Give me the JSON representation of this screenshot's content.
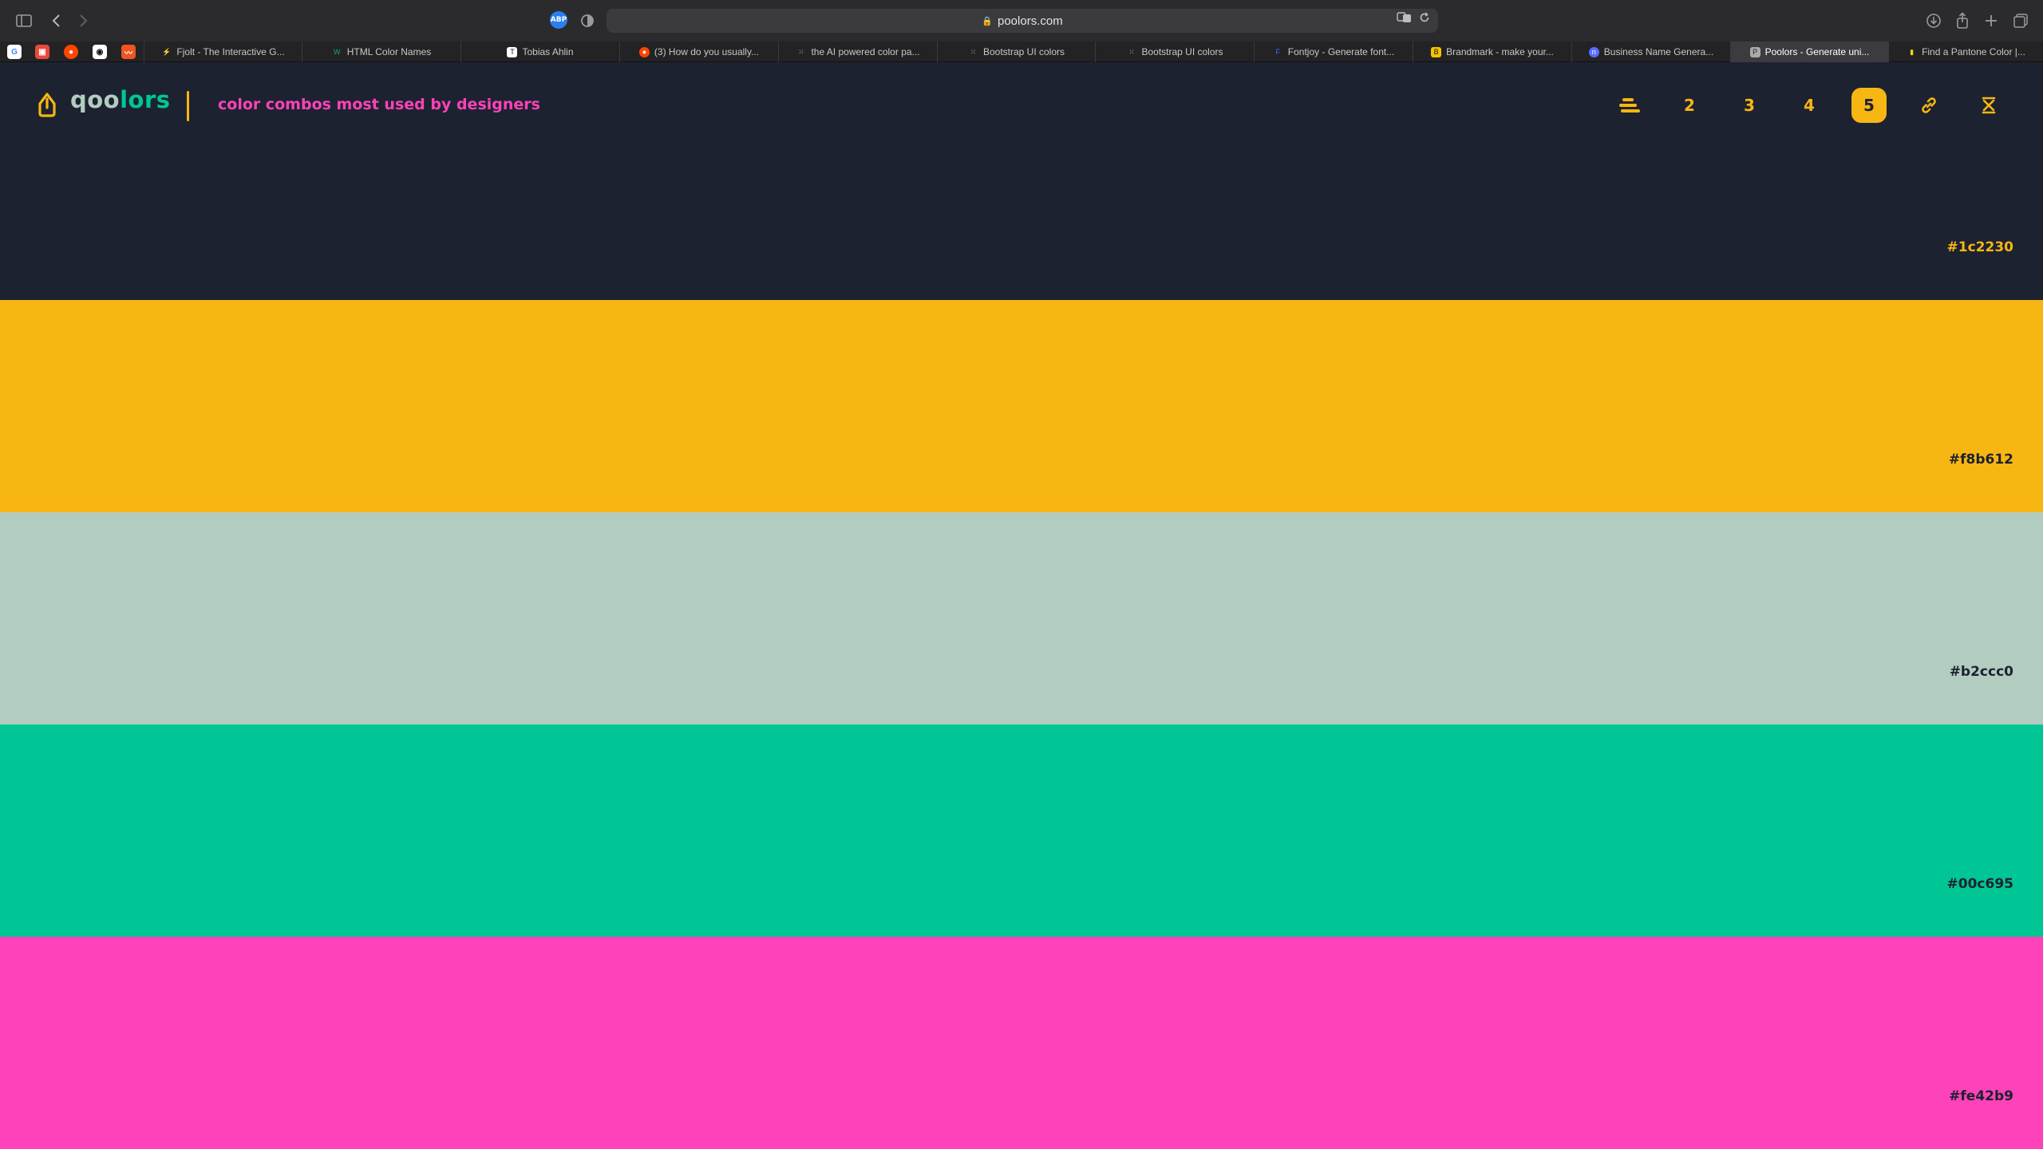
{
  "browser": {
    "url": "poolors.com",
    "extension_badge": "ABP",
    "pinned_tabs": [
      {
        "icon": "google-icon",
        "color": "#ffffff"
      },
      {
        "icon": "red-app-icon",
        "color": "#e84a3c"
      },
      {
        "icon": "reddit-icon",
        "color": "#ff4500"
      },
      {
        "icon": "github-icon",
        "color": "#ffffff"
      },
      {
        "icon": "orange-app-icon",
        "color": "#ee5522"
      }
    ],
    "tabs": [
      {
        "label": "Fjolt - The Interactive G...",
        "fav": "⚡",
        "color": "#e8a317"
      },
      {
        "label": "HTML Color Names",
        "fav": "W",
        "color": "#04aa6d"
      },
      {
        "label": "Tobias Ahlin",
        "fav": "T",
        "color": "#ffffff"
      },
      {
        "label": "(3) How do you usually...",
        "fav": "●",
        "color": "#ff4500"
      },
      {
        "label": "the AI powered color pa...",
        "fav": "⁙",
        "color": "#cccccc"
      },
      {
        "label": "Bootstrap UI colors",
        "fav": "⁙",
        "color": "#cccccc"
      },
      {
        "label": "Bootstrap UI colors",
        "fav": "⁙",
        "color": "#cccccc"
      },
      {
        "label": "Fontjoy - Generate font...",
        "fav": "F",
        "color": "#3b6cff"
      },
      {
        "label": "Brandmark - make your...",
        "fav": "B",
        "color": "#f8c300"
      },
      {
        "label": "Business Name Genera...",
        "fav": "n",
        "color": "#5b6cff"
      },
      {
        "label": "Poolors - Generate uni...",
        "fav": "P",
        "color": "#aaaaaa"
      },
      {
        "label": "Find a Pantone Color |...",
        "fav": "▮",
        "color": "#f2d21b"
      }
    ]
  },
  "header": {
    "logo_part1": "qoo",
    "logo_part2": "lors",
    "tagline": "color combos most used by designers",
    "nav": [
      {
        "label": "",
        "icon": "layers-icon"
      },
      {
        "label": "2"
      },
      {
        "label": "3"
      },
      {
        "label": "4"
      },
      {
        "label": "5",
        "active": true
      },
      {
        "label": "",
        "icon": "link-icon"
      },
      {
        "label": "",
        "icon": "shuffle-icon"
      }
    ]
  },
  "palette": [
    {
      "hex": "#1c2230",
      "text_color": "#f8b612"
    },
    {
      "hex": "#f8b612",
      "text_color": "#1c2230"
    },
    {
      "hex": "#b2ccc0",
      "text_color": "#1c2230"
    },
    {
      "hex": "#00c695",
      "text_color": "#1c2230"
    },
    {
      "hex": "#fe42b9",
      "text_color": "#1c2230"
    }
  ]
}
